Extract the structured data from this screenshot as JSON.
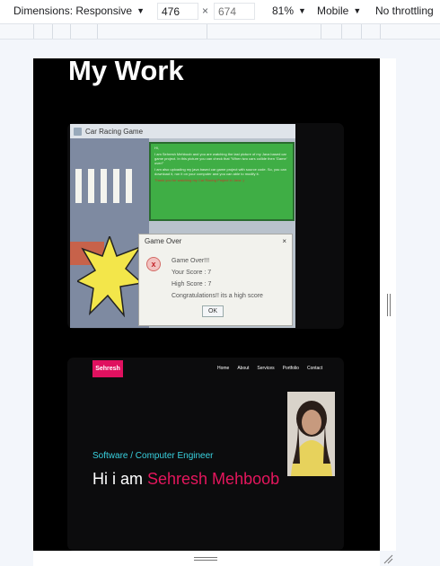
{
  "devtools": {
    "dimensions_label": "Dimensions: Responsive",
    "width_value": "476",
    "height_placeholder": "674",
    "times": "×",
    "zoom": "81%",
    "device_type": "Mobile",
    "throttling": "No throttling"
  },
  "page": {
    "heading": "My Work",
    "projects": [
      {
        "game": {
          "window_title": "Car Racing Game",
          "panel_lines": [
            "Hi,",
            "I am Sehresh Mehboob and you are watching the last picture of my Java based car game project. In this picture you can check that \"When two cars collide then 'Game' over!\"",
            "I am also uploading my java based car game project with source code. So, you can download it, run it on your computer and you can able to modify it.",
            "Thank you for watching my Car Racing Project in Java :)"
          ],
          "dialog": {
            "title": "Game Over",
            "close": "×",
            "error_icon": "x",
            "line1": "Game Over!!!",
            "line2": "Your Score : 7",
            "line3": "High Score : 7",
            "line4": "Congratulations!! its a high score",
            "ok_label": "OK"
          }
        }
      },
      {
        "portfolio": {
          "logo": "Sehresh",
          "nav": [
            "Home",
            "About",
            "Services",
            "Portfolio",
            "Contact"
          ],
          "subtitle": "Software / Computer Engineer",
          "greeting_prefix": "Hi i am ",
          "name": "Sehresh Mehboob"
        }
      }
    ]
  },
  "colors": {
    "viewport_bg": "#000000",
    "accent_pink": "#e5165d",
    "accent_cyan": "#39d2e0",
    "game_panel": "#3fae45"
  }
}
